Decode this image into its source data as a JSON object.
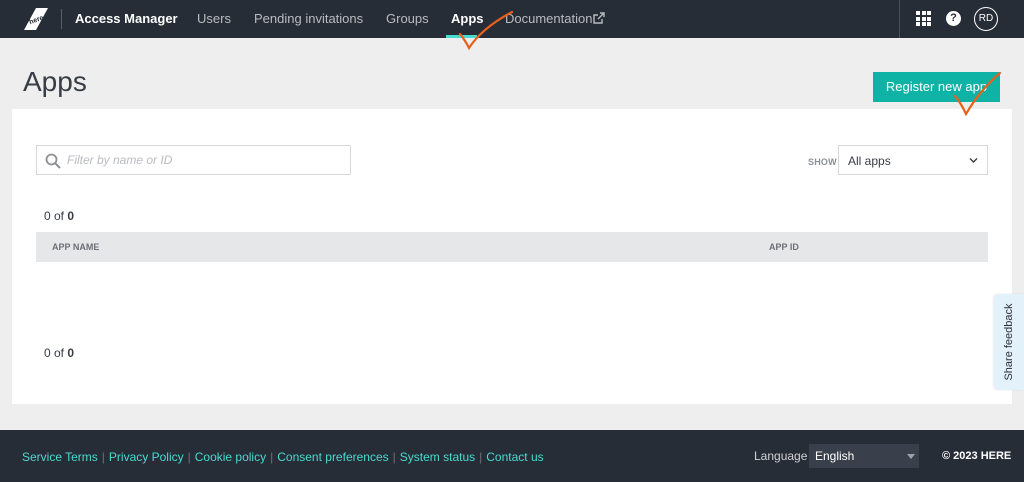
{
  "brand": {
    "logo_text": "here",
    "app_name": "Access Manager"
  },
  "nav": {
    "items": [
      {
        "label": "Users",
        "active": false
      },
      {
        "label": "Pending invitations",
        "active": false
      },
      {
        "label": "Groups",
        "active": false
      },
      {
        "label": "Apps",
        "active": true
      },
      {
        "label": "Documentation",
        "active": false,
        "icon": "external-link-icon"
      }
    ],
    "avatar_initials": "RD",
    "help_glyph": "?"
  },
  "page": {
    "title": "Apps",
    "register_button": "Register new app"
  },
  "filter": {
    "placeholder": "Filter by name or ID",
    "show_label": "SHOW",
    "show_value": "All apps"
  },
  "results": {
    "count_prefix": "0 of ",
    "count_total": "0",
    "columns": [
      "APP NAME",
      "APP ID"
    ],
    "rows": []
  },
  "feedback": {
    "label": "Share feedback"
  },
  "footer": {
    "links": [
      "Service Terms",
      "Privacy Policy",
      "Cookie policy",
      "Consent preferences",
      "System status",
      "Contact us"
    ],
    "language_label": "Language",
    "language_value": "English",
    "copyright": "© 2023 HERE"
  },
  "colors": {
    "accent": "#0fb3a6",
    "nav_bg": "#272d37",
    "link": "#48dad0",
    "annotation": "#e8601c"
  }
}
